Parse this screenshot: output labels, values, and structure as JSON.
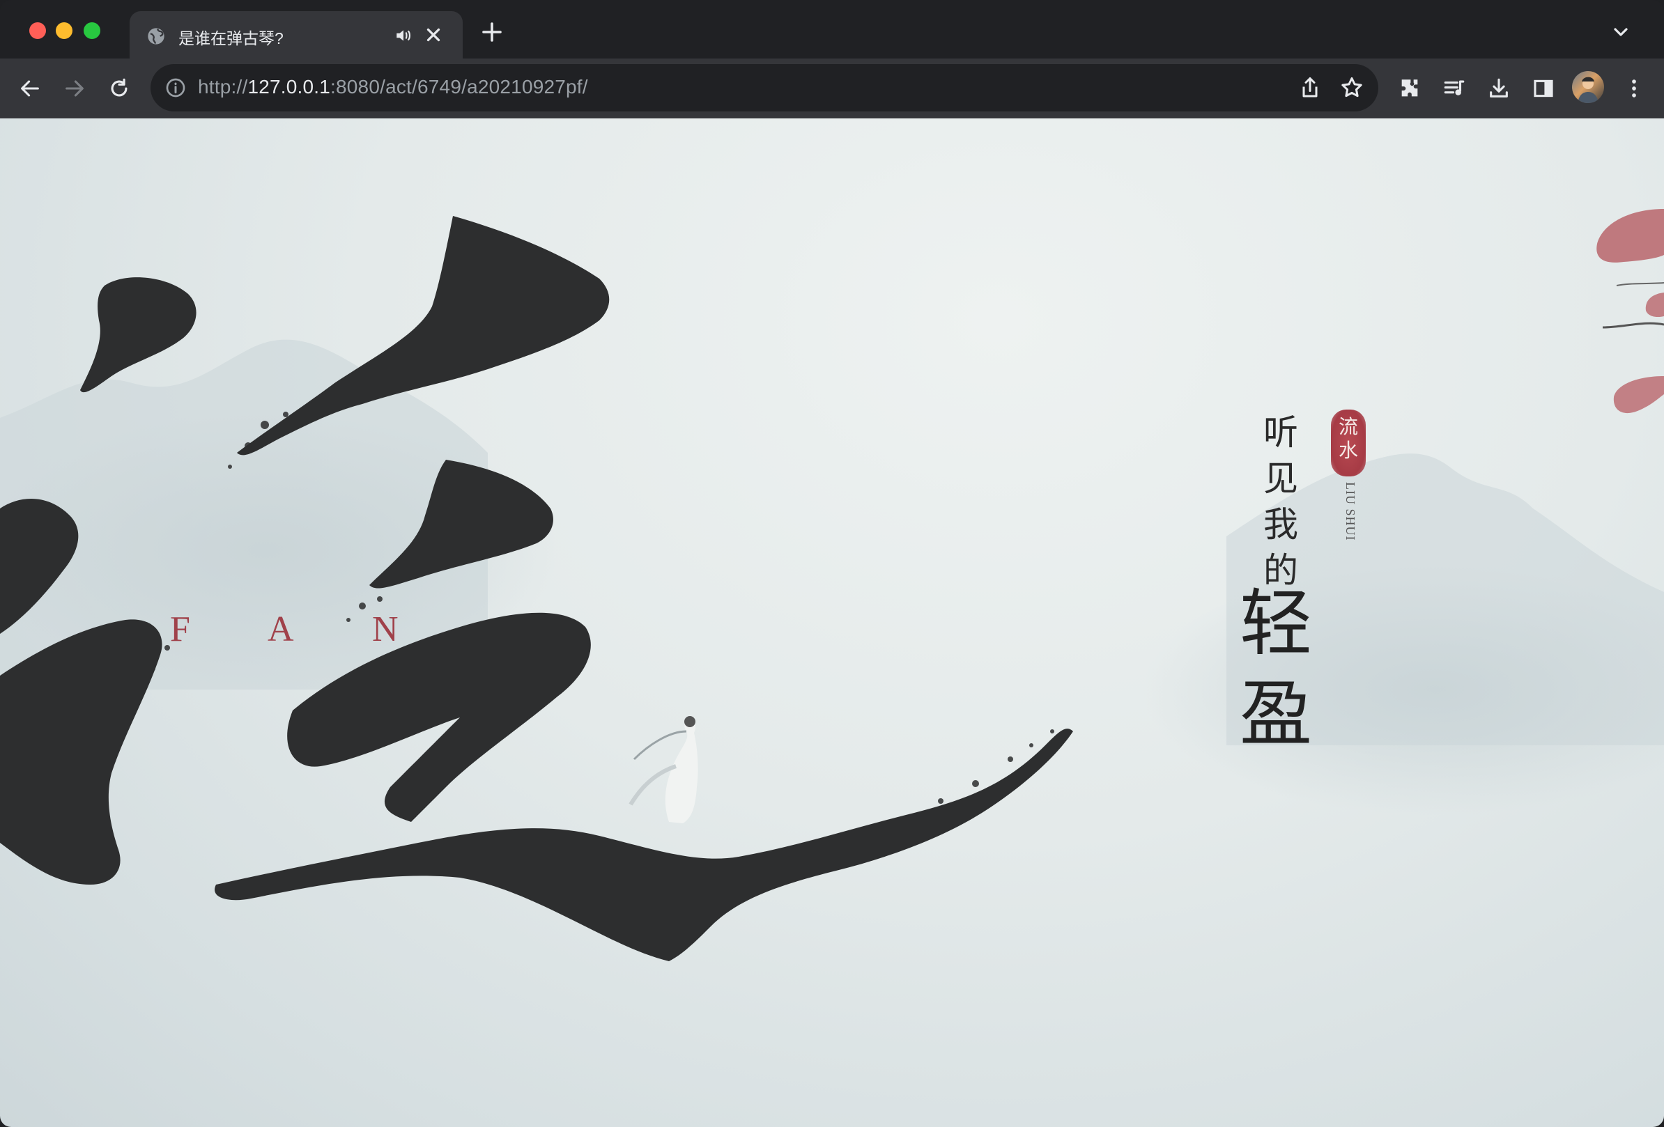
{
  "browser": {
    "tab": {
      "title": "是谁在弹古琴?",
      "favicon": "globe-icon",
      "audio_icon": "speaker-icon"
    },
    "address": {
      "scheme": "http://",
      "host": "127.0.0.1",
      "rest": ":8080/act/6749/a20210927pf/"
    },
    "toolbar_icons": [
      "back-arrow-icon",
      "forward-arrow-icon",
      "reload-icon",
      "info-icon",
      "share-icon",
      "star-icon",
      "puzzle-extensions-icon",
      "media-playlist-icon",
      "download-icon",
      "side-panel-icon",
      "profile-avatar",
      "kebab-menu-icon"
    ]
  },
  "page": {
    "calligraphy_char": "泛",
    "fan_letters": [
      "F",
      "A",
      "N"
    ],
    "poem_small": [
      "听",
      "见",
      "我",
      "的"
    ],
    "poem_big": [
      "轻",
      "盈"
    ],
    "seal_chars": [
      "流",
      "水"
    ],
    "seal_pinyin": "LIU SHUI",
    "colors": {
      "ink": "#2d2e2f",
      "seal_red": "#a63b45",
      "background": "#e4eaea"
    }
  }
}
